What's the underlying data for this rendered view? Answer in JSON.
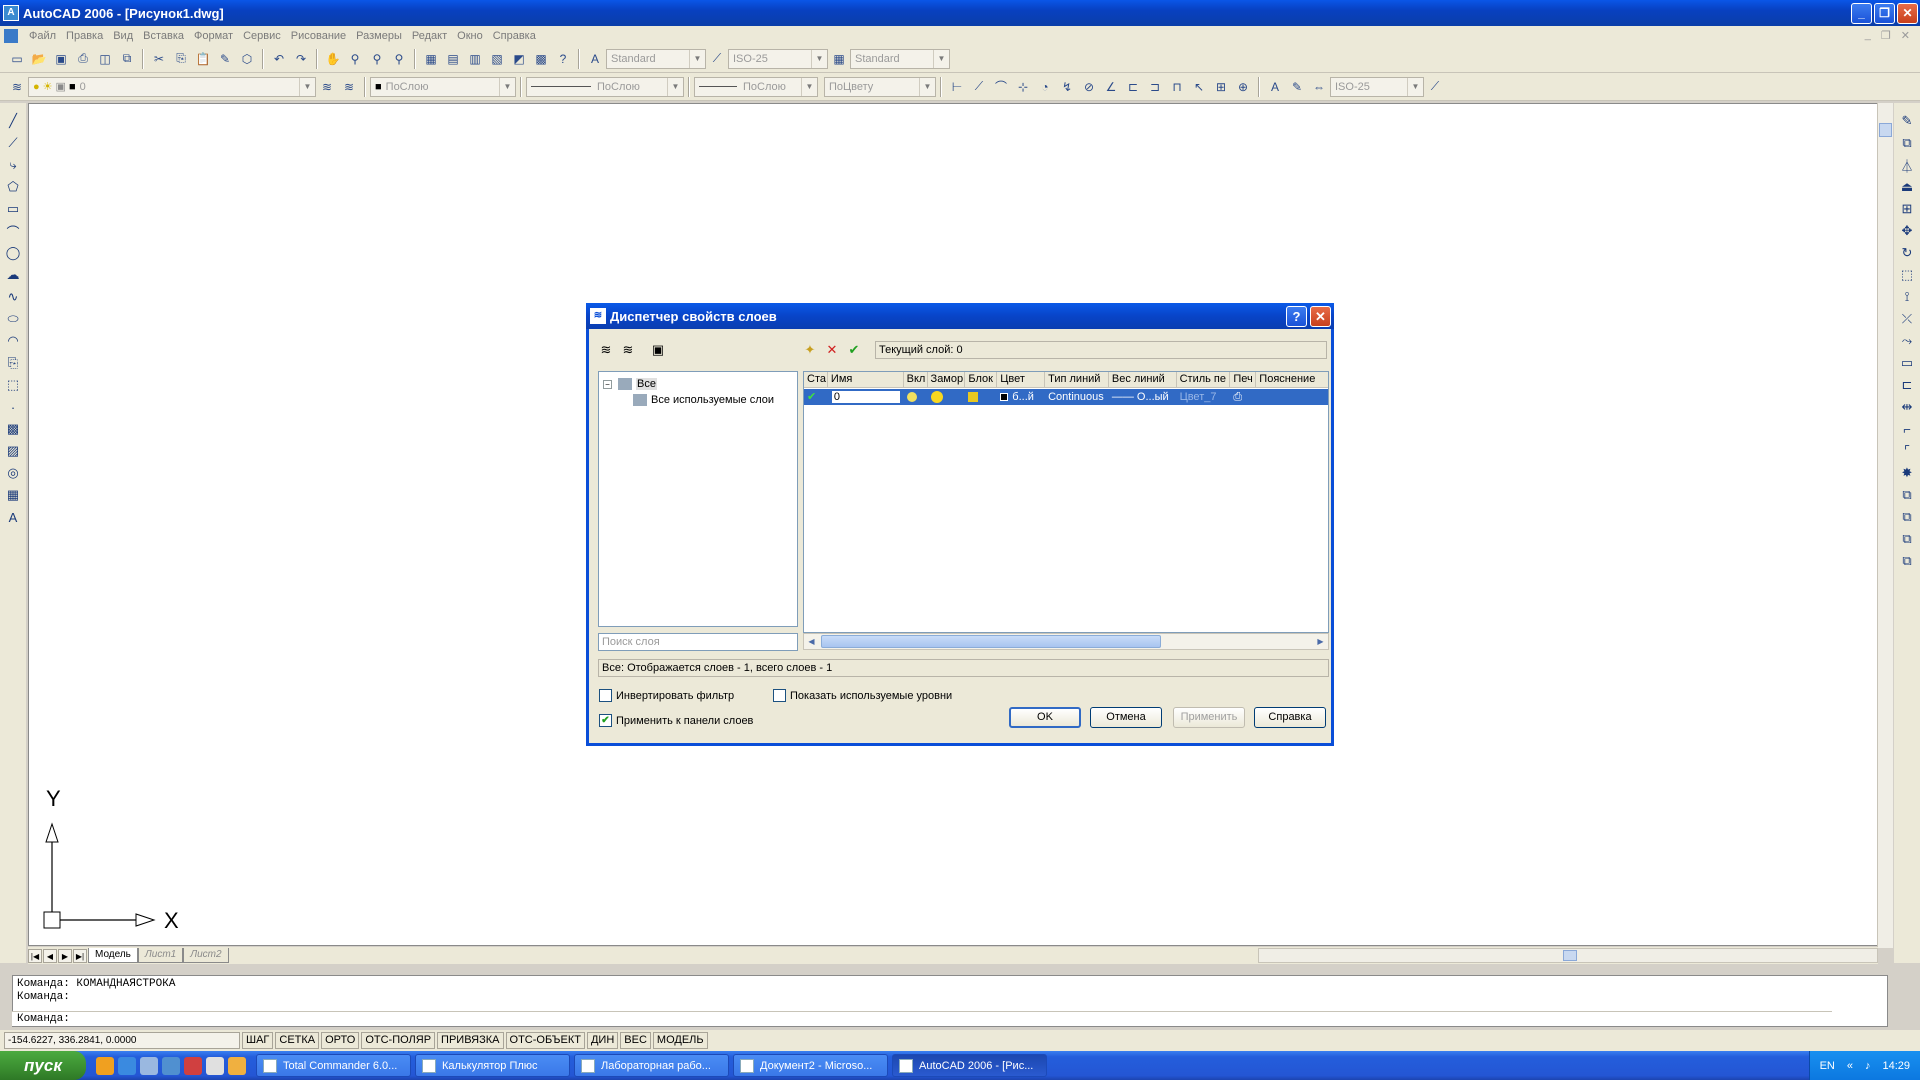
{
  "window": {
    "title": "AutoCAD 2006 - [Рисунок1.dwg]",
    "app_icon": "autocad-icon"
  },
  "menubar": {
    "items": [
      "Файл",
      "Правка",
      "Вид",
      "Вставка",
      "Формат",
      "Сервис",
      "Рисование",
      "Размеры",
      "Редакт",
      "Окно",
      "Справка"
    ]
  },
  "toolbar1": {
    "text_style": "Standard",
    "dim_style": "ISO-25",
    "table_style": "Standard"
  },
  "toolbar2": {
    "layer": "0",
    "color": "ПоСлою",
    "linetype": "ПоСлою",
    "lineweight": "ПоСлою",
    "plot_style": "ПоЦвету",
    "dim_style": "ISO-25"
  },
  "ucs": {
    "x_label": "X",
    "y_label": "Y"
  },
  "layout_tabs": [
    "Модель",
    "Лист1",
    "Лист2"
  ],
  "command": {
    "line1": "Команда: КОМАНДНАЯСТРОКА",
    "line2": "Команда:",
    "prompt": "Команда:"
  },
  "statusbar": {
    "coords": "-154.6227, 336.2841, 0.0000",
    "buttons": [
      "ШАГ",
      "СЕТКА",
      "ОРТО",
      "ОТС-ПОЛЯР",
      "ПРИВЯЗКА",
      "ОТС-ОБЪЕКТ",
      "ДИН",
      "ВЕС",
      "МОДЕЛЬ"
    ]
  },
  "taskbar": {
    "start": "пуск",
    "tasks": [
      "Total Commander 6.0...",
      "Калькулятор Плюс",
      "Лабораторная рабо...",
      "Документ2 - Microso...",
      "AutoCAD 2006 - [Рис..."
    ],
    "lang": "EN",
    "time": "14:29"
  },
  "dialog": {
    "title": "Диспетчер свойств слоев",
    "current_layer": "Текущий слой: 0",
    "tree": {
      "root": "Все",
      "child": "Все используемые слои"
    },
    "search_placeholder": "Поиск слоя",
    "columns": [
      "Ста",
      "Имя",
      "Вкл",
      "Замор",
      "Блок",
      "Цвет",
      "Тип линий",
      "Вес линий",
      "Стиль пе",
      "Печ",
      "Пояснение"
    ],
    "row": {
      "name": "0",
      "color": "б...й",
      "linetype": "Continuous",
      "lineweight": "—— О...ый",
      "plot_style": "Цвет_7"
    },
    "status": "Все: Отображается слоев - 1, всего слоев - 1",
    "invert_filter": "Инвертировать фильтр",
    "show_used": "Показать используемые уровни",
    "apply_to_toolbar": "Применить к панели слоев",
    "buttons": {
      "ok": "OK",
      "cancel": "Отмена",
      "apply": "Применить",
      "help": "Справка"
    }
  }
}
